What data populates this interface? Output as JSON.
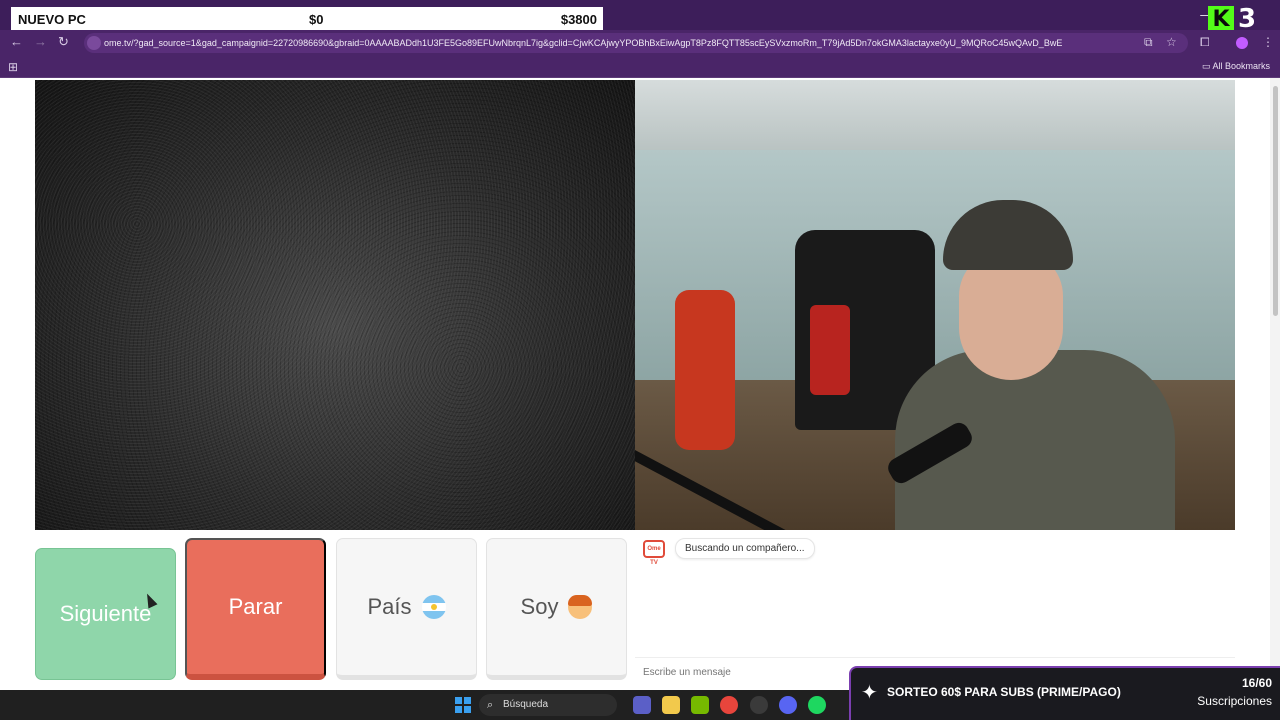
{
  "overlay_goal": {
    "title": "NUEVO PC",
    "current": "$0",
    "target": "$3800"
  },
  "overlay_kick": {
    "logo": "K",
    "number": "3"
  },
  "browser": {
    "url": "ome.tv/?gad_source=1&gad_campaignid=22720986690&gbraid=0AAAABADdh1U3FE5Go89EFUwNbrqnL7ig&gclid=CjwKCAjwyYPOBhBxEiwAgpT8Pz8FQTT85scEySVxzmoRm_T79jAd5Dn7okGMA3lactayxe0yU_9MQRoC45wQAvD_BwE",
    "all_bookmarks": "All Bookmarks"
  },
  "controls": {
    "next": "Siguiente",
    "stop": "Parar",
    "country": "País",
    "gender": "Soy"
  },
  "chat": {
    "logo_text": "Ome TV",
    "status": "Buscando un compañero...",
    "input_placeholder": "Escribe un mensaje"
  },
  "promo": {
    "text": "SORTEO 60$ PARA SUBS (PRIME/PAGO)",
    "count": "16/60",
    "label": "Suscripciones"
  },
  "taskbar": {
    "search_label": "Búsqueda"
  },
  "colors": {
    "next": "#8fd6aa",
    "stop": "#e96e5c",
    "chrome": "#4a2568",
    "kick": "#53fc18"
  }
}
